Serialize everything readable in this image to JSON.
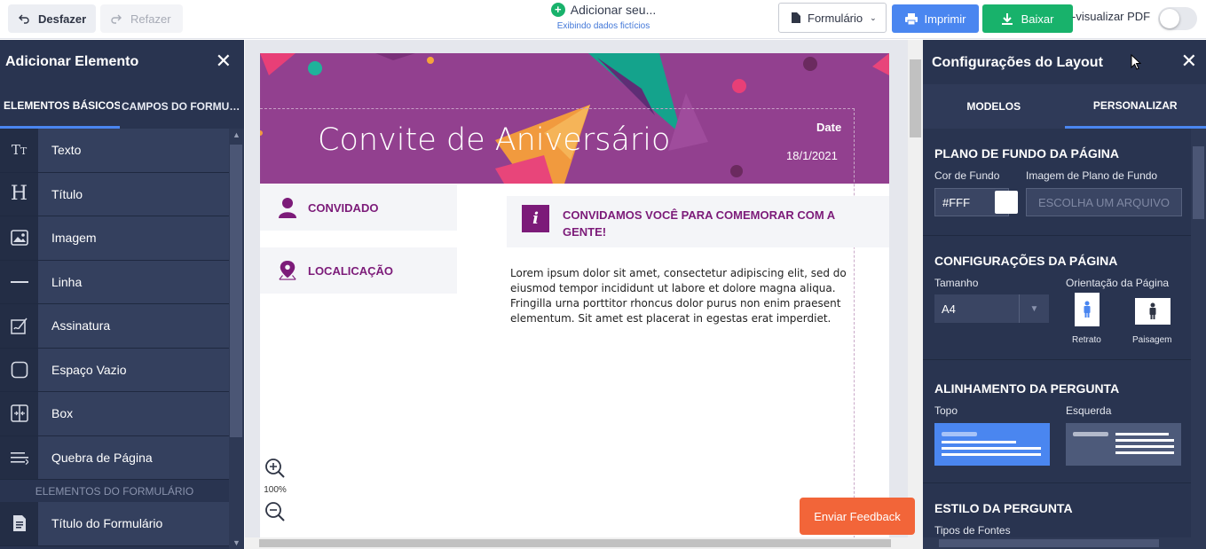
{
  "toolbar": {
    "undo_label": "Desfazer",
    "redo_label": "Refazer",
    "add_label": "Adicionar seu...",
    "sub_label": "Exibindo dados fictícios",
    "form_label": "Formulário",
    "print_label": "Imprimir",
    "download_label": "Baixar",
    "pdf_preview_label": "-visualizar PDF"
  },
  "left_panel": {
    "title": "Adicionar Elemento",
    "tabs": [
      "ELEMENTOS BÁSICOS",
      "CAMPOS DO FORMULÁRIO"
    ],
    "items": [
      {
        "label": "Texto",
        "icon": "text-size-icon"
      },
      {
        "label": "Título",
        "icon": "heading-icon"
      },
      {
        "label": "Imagem",
        "icon": "image-icon"
      },
      {
        "label": "Linha",
        "icon": "line-icon"
      },
      {
        "label": "Assinatura",
        "icon": "signature-icon"
      },
      {
        "label": "Espaço Vazio",
        "icon": "empty-space-icon"
      },
      {
        "label": "Box",
        "icon": "box-icon"
      },
      {
        "label": "Quebra de Página",
        "icon": "page-break-icon"
      }
    ],
    "section_label": "ELEMENTOS DO FORMULÁRIO",
    "form_items": [
      {
        "label": "Título do Formulário",
        "icon": "form-title-icon"
      }
    ]
  },
  "document": {
    "title": "Convite de Aniversário",
    "date_label": "Date",
    "date_value": "18/1/2021",
    "guest_label": "CONVIDADO",
    "location_label": "LOCALICAÇÃO",
    "info_title": "CONVIDAMOS VOCÊ PARA COMEMORAR COM A GENTE!",
    "body_text": "Lorem ipsum dolor sit amet, consectetur adipiscing elit, sed do eiusmod tempor incididunt ut labore et dolore magna aliqua. Fringilla urna porttitor rhoncus dolor purus non enim praesent elementum. Sit amet est placerat in egestas erat imperdiet.",
    "zoom_level": "100%",
    "banner_color": "#92408f",
    "accent_color": "#7c1b79"
  },
  "feedback_label": "Enviar Feedback",
  "right_panel": {
    "title": "Configurações do Layout",
    "tabs": [
      "MODELOS",
      "PERSONALIZAR"
    ],
    "bg_section": {
      "title": "PLANO DE FUNDO DA PÁGINA",
      "color_label": "Cor de Fundo",
      "color_value": "#FFF",
      "image_label": "Imagem de Plano de Fundo",
      "file_placeholder": "ESCOLHA UM ARQUIVO"
    },
    "page_section": {
      "title": "CONFIGURAÇÕES DA PÁGINA",
      "size_label": "Tamanho",
      "size_value": "A4",
      "orientation_label": "Orientação da Página",
      "portrait_label": "Retrato",
      "landscape_label": "Paisagem"
    },
    "align_section": {
      "title": "ALINHAMENTO DA PERGUNTA",
      "top_label": "Topo",
      "left_label": "Esquerda"
    },
    "style_section": {
      "title": "ESTILO DA PERGUNTA",
      "font_label": "Tipos de Fontes"
    }
  },
  "colors": {
    "print": "#4a86f0",
    "download": "#18b26b",
    "feedback": "#f26539",
    "panel": "#293450"
  }
}
